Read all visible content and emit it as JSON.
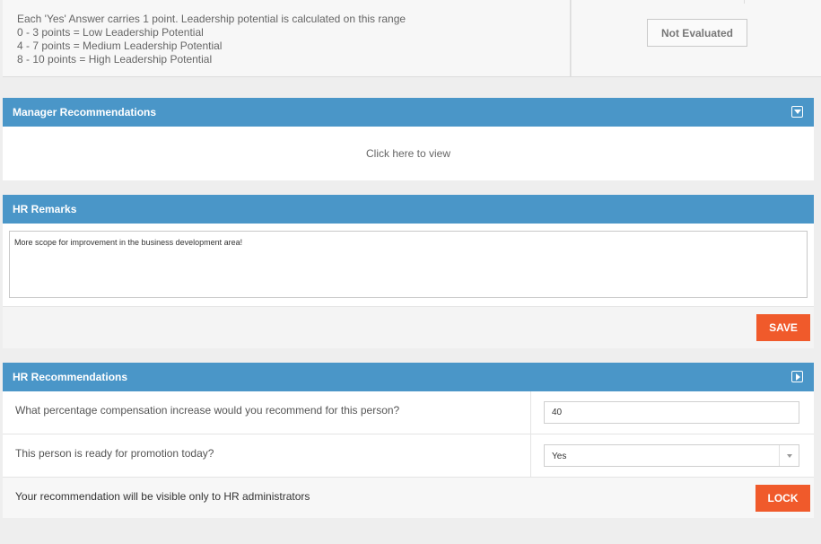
{
  "scoring": {
    "lines": [
      "Each 'Yes' Answer carries 1 point. Leadership potential is calculated on this range",
      "0 - 3 points = Low Leadership Potential",
      "4 - 7 points = Medium Leadership Potential",
      "8 - 10 points = High Leadership Potential"
    ],
    "status_label": "Not Evaluated"
  },
  "manager_recommendations": {
    "title": "Manager Recommendations",
    "icon": "collapse-down-icon",
    "link_text": "Click here to view"
  },
  "hr_remarks": {
    "title": "HR Remarks",
    "text": "More scope for improvement in the business development area!",
    "save_label": "SAVE"
  },
  "hr_recommendations": {
    "title": "HR Recommendations",
    "icon": "expand-right-icon",
    "q1": "What percentage compensation increase would you recommend for this person?",
    "q1_value": "40",
    "q2": "This person is ready for promotion today?",
    "q2_value": "Yes",
    "note": "Your recommendation will be visible only to HR administrators",
    "lock_label": "LOCK"
  },
  "colors": {
    "header_blue": "#4a96c8",
    "button_orange": "#f05a2b",
    "page_bg": "#eeeeee"
  }
}
